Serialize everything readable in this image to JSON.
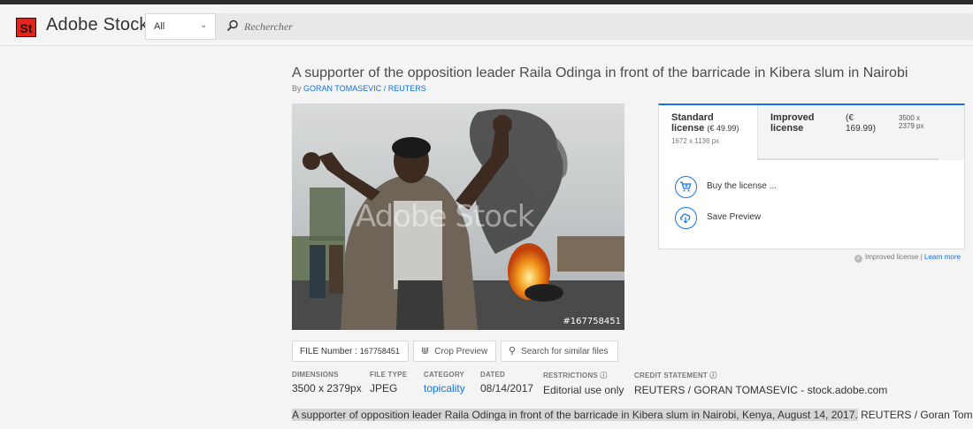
{
  "header": {
    "logo_badge": "St",
    "brand": "Adobe Stock",
    "filter_value": "All",
    "search_placeholder": "Rechercher"
  },
  "asset": {
    "title": "A supporter of the opposition leader Raila Odinga in front of the barricade in Kibera slum in Nairobi",
    "by_prefix": "By",
    "author": "GORAN TOMASEVIC / REUTERS",
    "watermark": "Adobe Stock",
    "photo_id": "#167758451",
    "file_label": "FILE",
    "number_label": "Number :",
    "file_number": "167758451",
    "crop_preview": "Crop Preview",
    "search_similar": "Search for similar files"
  },
  "metadata": {
    "dimensions_label": "DIMENSIONS",
    "dimensions_value": "3500 x 2379px",
    "filetype_label": "FILE TYPE",
    "filetype_value": "JPEG",
    "category_label": "CATEGORY",
    "category_value": "topicality",
    "dated_label": "DATED",
    "dated_value": "08/14/2017",
    "restrictions_label": "RESTRICTIONS ⓘ",
    "restrictions_value": "Editorial use only",
    "credit_label": "CREDIT STATEMENT ⓘ",
    "credit_value": "REUTERS / GORAN TOMASEVIC - stock.adobe.com"
  },
  "caption": {
    "highlighted": "A supporter of opposition leader Raila Odinga in front of the barricade in Kibera slum in Nairobi, Kenya, August 14, 2017.",
    "rest": " REUTERS / Goran Tomasevic"
  },
  "license": {
    "standard_title": "Standard",
    "standard_word": "license",
    "standard_price": "(€ 49.99)",
    "standard_dims": "1672 x 1136 px",
    "improved_title": "Improved",
    "improved_word": "license",
    "improved_price_line1": "(€",
    "improved_price_line2": "169.99)",
    "improved_dims_line1": "3500 x",
    "improved_dims_line2": "2379 px",
    "buy_label": "Buy the license ...",
    "save_label": "Save Preview",
    "note_text": "Improved license |",
    "note_link": "Learn more"
  },
  "colors": {
    "accent": "#1473e6",
    "logo_red": "#e3241b"
  }
}
